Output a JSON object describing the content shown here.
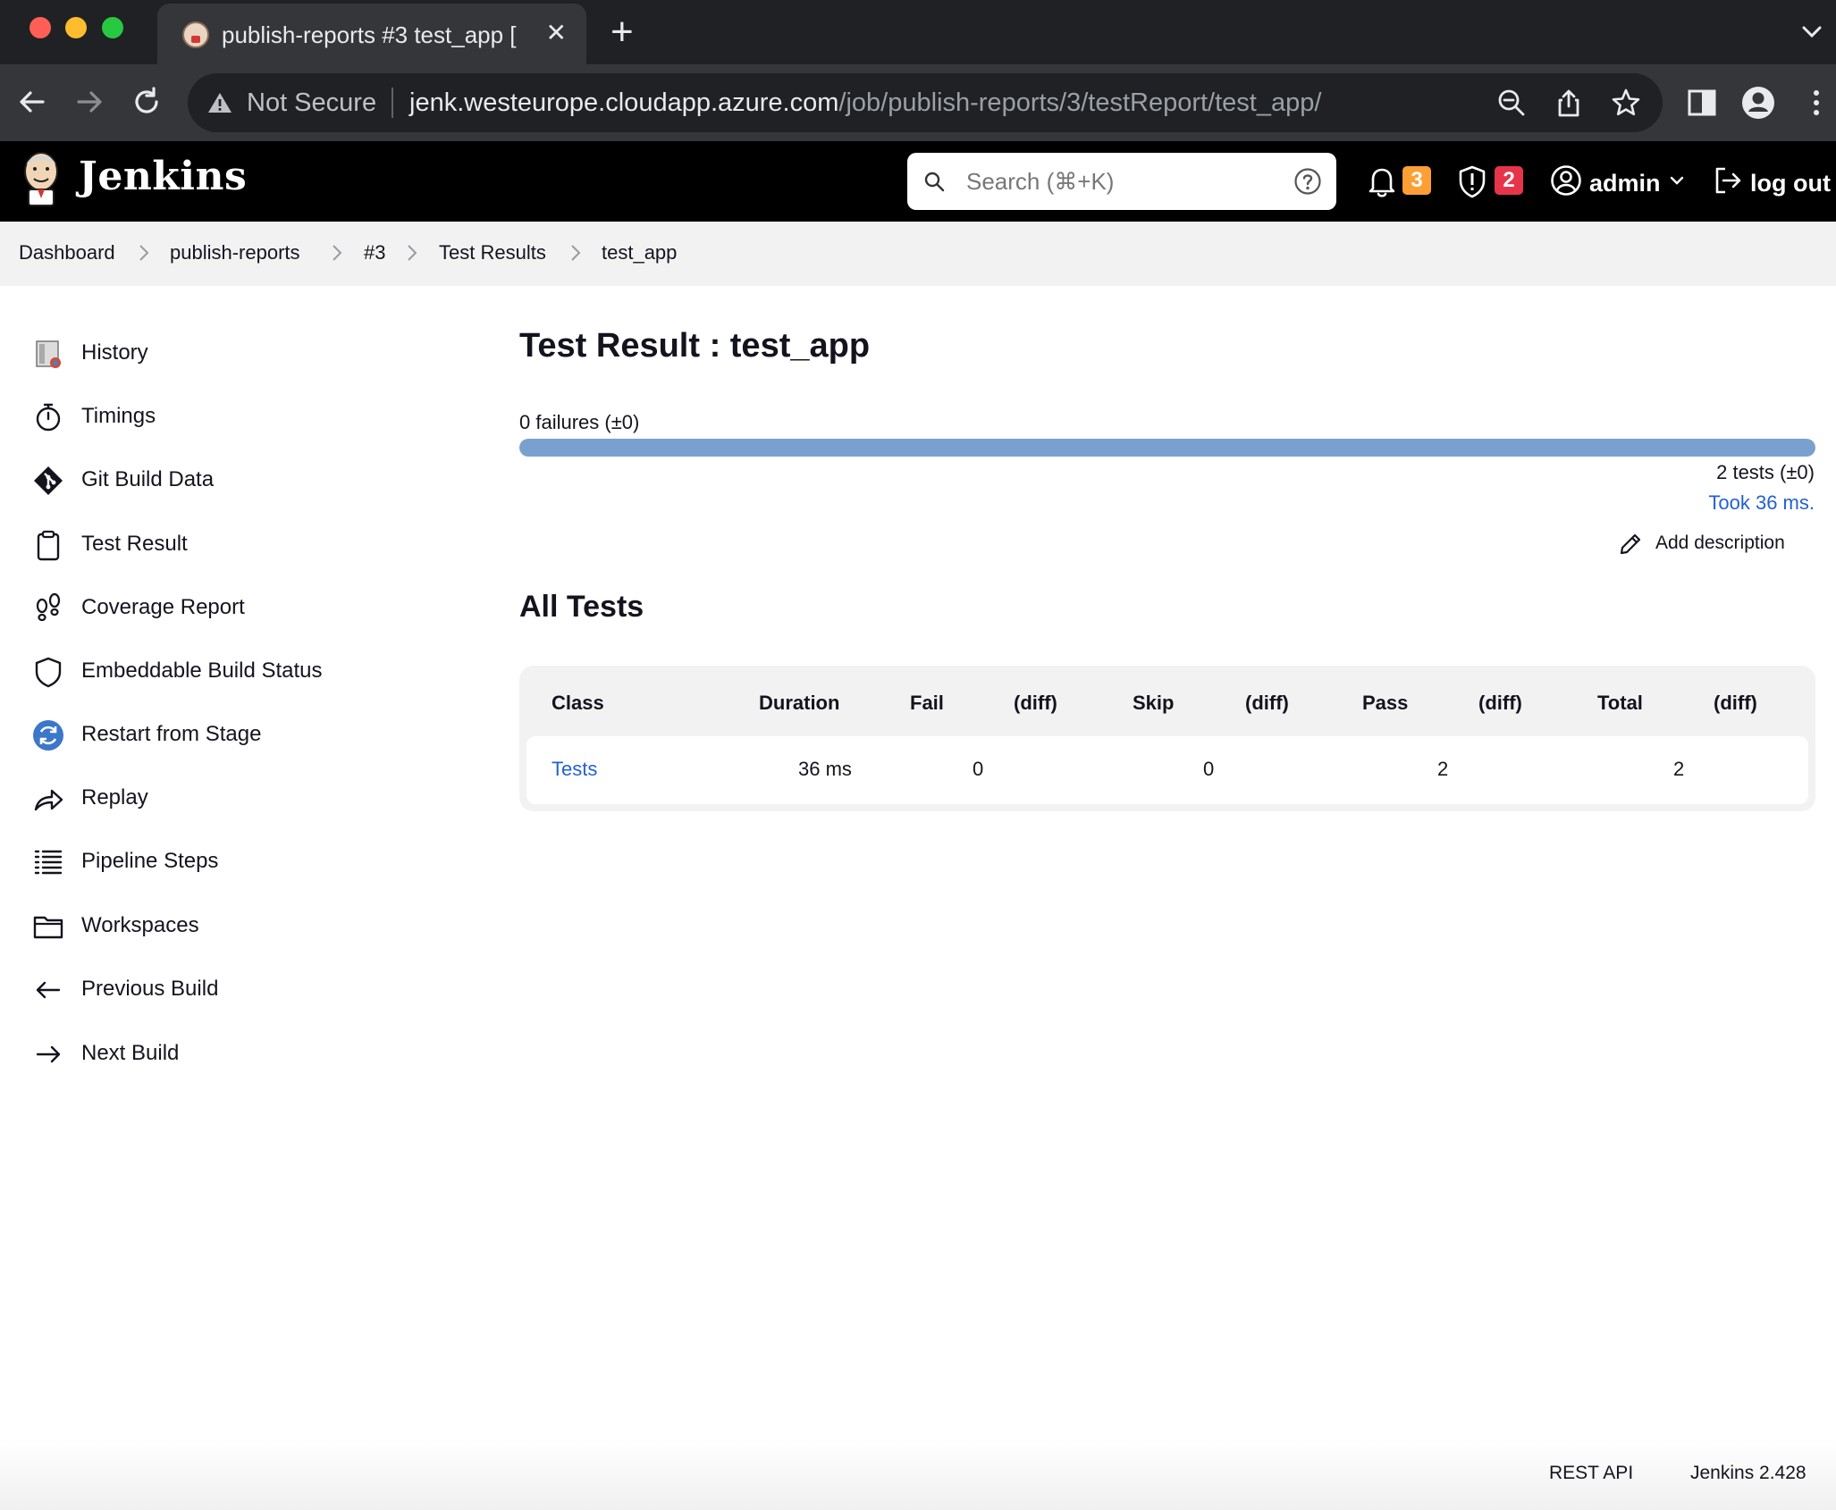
{
  "browser": {
    "tab_title": "publish-reports #3 test_app [Jenkins]",
    "tab_close": "✕",
    "new_tab": "+",
    "not_secure": "Not Secure",
    "url_host": "jenk.westeurope.cloudapp.azure.com",
    "url_path": "/job/publish-reports/3/testReport/test_app/"
  },
  "header": {
    "app_name": "Jenkins",
    "search_placeholder": "Search (⌘+K)",
    "notifications_count": "3",
    "security_count": "2",
    "user": "admin",
    "logout": "log out"
  },
  "breadcrumb": [
    "Dashboard",
    "publish-reports",
    "#3",
    "Test Results",
    "test_app"
  ],
  "sidebar": {
    "items": [
      {
        "label": "History",
        "icon": "history-icon"
      },
      {
        "label": "Timings",
        "icon": "stopwatch-icon"
      },
      {
        "label": "Git Build Data",
        "icon": "git-icon"
      },
      {
        "label": "Test Result",
        "icon": "clipboard-icon"
      },
      {
        "label": "Coverage Report",
        "icon": "footsteps-icon"
      },
      {
        "label": "Embeddable Build Status",
        "icon": "shield-icon"
      },
      {
        "label": "Restart from Stage",
        "icon": "restart-icon"
      },
      {
        "label": "Replay",
        "icon": "replay-icon"
      },
      {
        "label": "Pipeline Steps",
        "icon": "list-icon"
      },
      {
        "label": "Workspaces",
        "icon": "folder-icon"
      },
      {
        "label": "Previous Build",
        "icon": "arrow-left-icon"
      },
      {
        "label": "Next Build",
        "icon": "arrow-right-icon"
      }
    ]
  },
  "main": {
    "title": "Test Result : test_app",
    "failures": "0 failures (±0)",
    "pass_fraction": 1.0,
    "tests_summary": "2 tests (±0)",
    "took": "Took 36 ms.",
    "add_description": "Add description",
    "all_tests_title": "All Tests",
    "table": {
      "headers": [
        "Class",
        "Duration",
        "Fail",
        "(diff)",
        "Skip",
        "(diff)",
        "Pass",
        "(diff)",
        "Total",
        "(diff)"
      ],
      "rows": [
        {
          "class": "Tests",
          "duration": "36 ms",
          "fail": "0",
          "fail_diff": "",
          "skip": "0",
          "skip_diff": "",
          "pass": "2",
          "pass_diff": "",
          "total": "2",
          "total_diff": ""
        }
      ]
    }
  },
  "footer": {
    "rest_api": "REST API",
    "version": "Jenkins 2.428"
  },
  "colors": {
    "progress_pass": "#7aa0cf",
    "link": "#2461d0",
    "badge_orange": "#fe9f35",
    "badge_red": "#e6354a"
  }
}
